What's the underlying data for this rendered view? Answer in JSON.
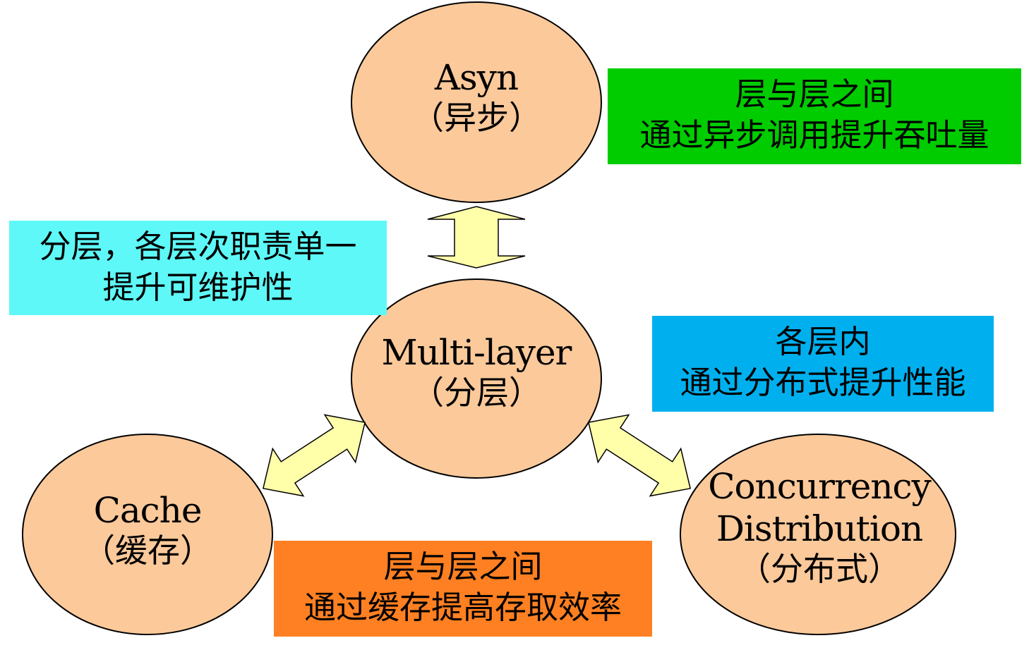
{
  "colors": {
    "ellipse_fill": "#FBC99A",
    "ellipse_stroke": "#000000",
    "arrow_fill": "#FFFFAA",
    "arrow_stroke": "#000000",
    "green": "#00CC00",
    "cyan": "#5FF8F8",
    "blue": "#00B0EE",
    "orange": "#FF8022"
  },
  "nodes": {
    "asyn": {
      "title": "Asyn",
      "subtitle": "（异步）"
    },
    "multilayer": {
      "title": "Multi-layer",
      "subtitle": "（分层）"
    },
    "cache": {
      "title": "Cache",
      "subtitle": "（缓存）"
    },
    "concurrency": {
      "title": "Concurrency",
      "title2": "Distribution",
      "subtitle": "（分布式）"
    }
  },
  "callouts": {
    "asyn_note": {
      "line1": "层与层之间",
      "line2": "通过异步调用提升吞吐量"
    },
    "layer_note": {
      "line1": "分层，各层次职责单一",
      "line2": "提升可维护性"
    },
    "concurrency_note": {
      "line1": "各层内",
      "line2": "通过分布式提升性能"
    },
    "cache_note": {
      "line1": "层与层之间",
      "line2": "通过缓存提高存取效率"
    }
  }
}
